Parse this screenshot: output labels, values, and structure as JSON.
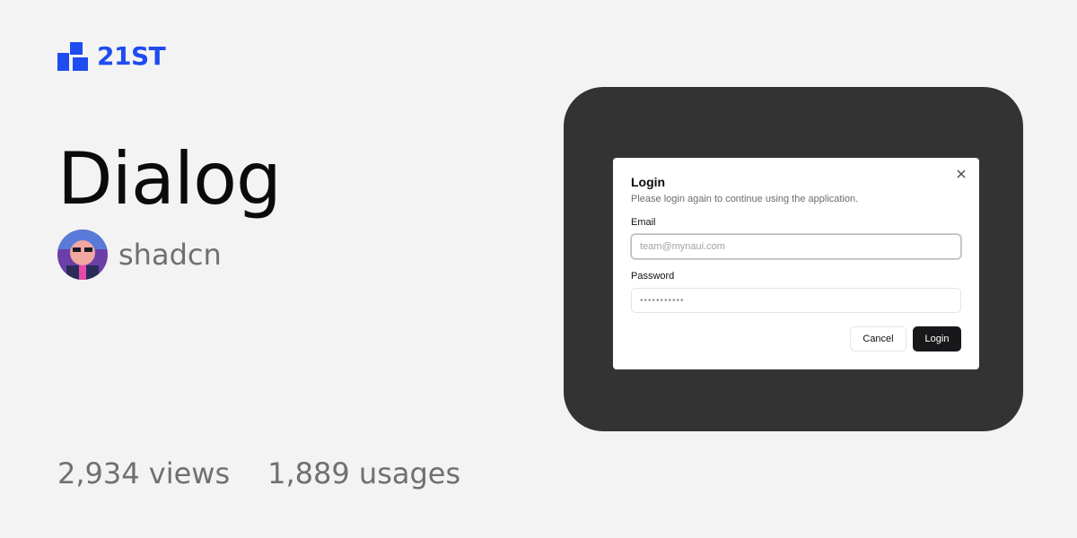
{
  "brand": {
    "name": "21ST",
    "color": "#1f4cf0",
    "icon": "21st-logo-icon"
  },
  "component": {
    "title": "Dialog",
    "author": "shadcn"
  },
  "stats": {
    "views": "2,934 views",
    "usages": "1,889 usages"
  },
  "preview": {
    "dialog": {
      "title": "Login",
      "description": "Please login again to continue using the application.",
      "close_icon": "close-icon",
      "email_label": "Email",
      "email_placeholder": "team@mynaui.com",
      "password_label": "Password",
      "password_value": "•••••••••••",
      "cancel_label": "Cancel",
      "login_label": "Login"
    }
  }
}
